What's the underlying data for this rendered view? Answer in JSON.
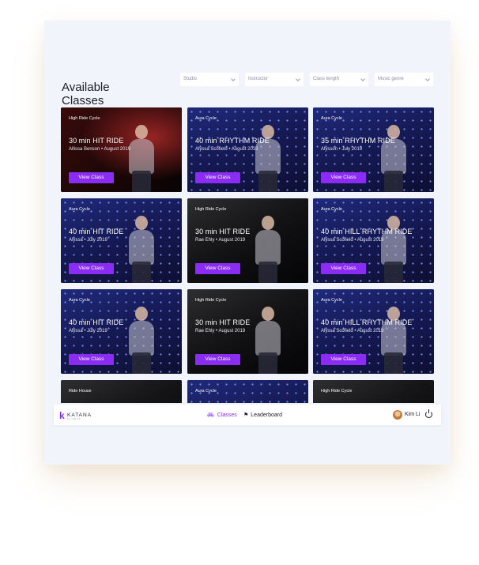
{
  "header": {
    "title": "Available Classes"
  },
  "filters": [
    {
      "placeholder": "Studio"
    },
    {
      "placeholder": "Instructor"
    },
    {
      "placeholder": "Class length"
    },
    {
      "placeholder": "Music genre"
    }
  ],
  "classes": [
    {
      "studio": "High Ride Cycle",
      "title": "30 min HIT RIDE",
      "meta": "Allissa Benson • August 2019",
      "button": "View Class"
    },
    {
      "studio": "Aura Cycle",
      "title": "40 min RHYTHM RIDE",
      "meta": "Alyssa Scofield • August 2019",
      "button": "View Class"
    },
    {
      "studio": "Aura Cycle",
      "title": "35 min RHYTHM RIDE",
      "meta": "Alysson • July 2019",
      "button": "View Class"
    },
    {
      "studio": "Aura Cycle",
      "title": "40 min HIT RIDE",
      "meta": "Alyssa • July 2019",
      "button": "View Class"
    },
    {
      "studio": "High Ride Cycle",
      "title": "30 min HIT RIDE",
      "meta": "Rae Ehly • August 2019",
      "button": "View Class"
    },
    {
      "studio": "Aura Cycle",
      "title": "40 min HILL RHYTHM RIDE",
      "meta": "Alyssa Scofield • August 2019",
      "button": "View Class"
    },
    {
      "studio": "Aura Cycle",
      "title": "40 min HIT RIDE",
      "meta": "Alyssa • July 2019",
      "button": "View Class"
    },
    {
      "studio": "High Ride Cycle",
      "title": "30 min HIT RIDE",
      "meta": "Rae Ehly • August 2019",
      "button": "View Class"
    },
    {
      "studio": "Aura Cycle",
      "title": "40 min HILL RHYTHM RIDE",
      "meta": "Alyssa Scofield • August 2019",
      "button": "View Class"
    },
    {
      "studio": "Ride House",
      "title": "",
      "meta": "",
      "button": ""
    },
    {
      "studio": "Aura Cycle",
      "title": "",
      "meta": "",
      "button": ""
    },
    {
      "studio": "High Ride Cycle",
      "title": "",
      "meta": "",
      "button": ""
    }
  ],
  "nav": {
    "logo_word": "KATANA",
    "logo_sub": "FITNESS",
    "classes_label": "Classes",
    "leaderboard_label": "Leaderboard",
    "user_name": "Kim Li"
  },
  "colors": {
    "accent": "#8b2cf5",
    "panel": "#f2f4fb"
  }
}
